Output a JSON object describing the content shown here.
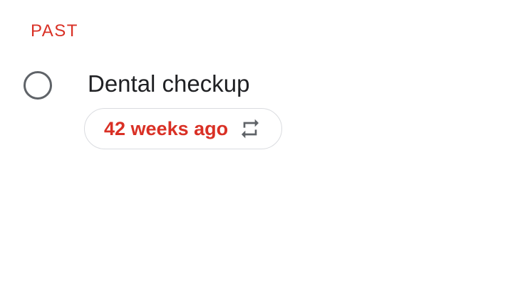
{
  "theme": {
    "accent_red": "#d93025",
    "text_primary": "#202124",
    "icon_gray": "#5f6368",
    "chip_border": "#dadce0"
  },
  "section": {
    "label": "PAST"
  },
  "task": {
    "title": "Dental checkup",
    "completed": false,
    "due_chip": {
      "label": "42 weeks ago",
      "icon": "repeat-icon"
    }
  }
}
